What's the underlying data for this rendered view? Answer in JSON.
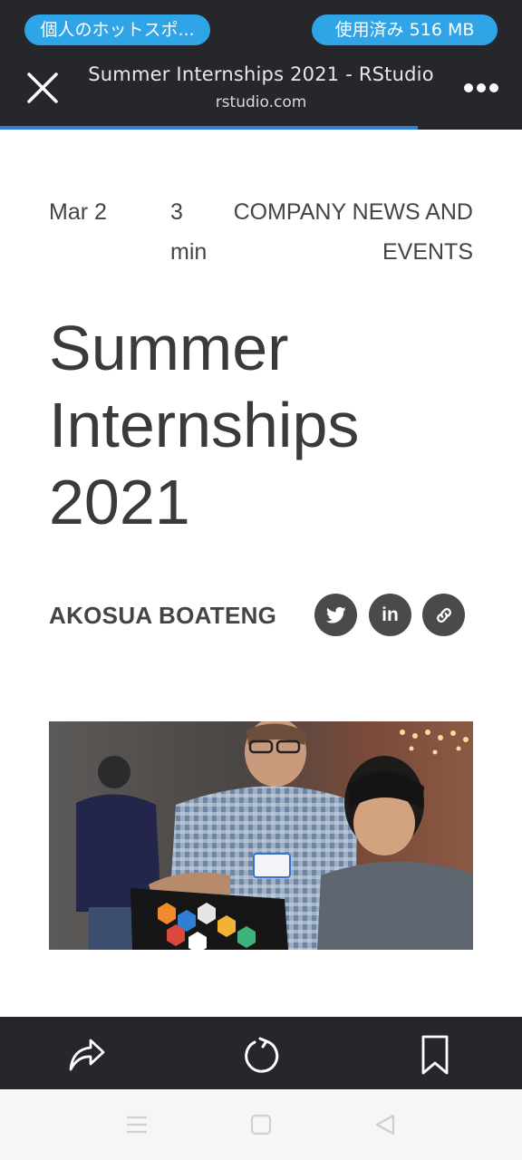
{
  "status": {
    "hotspot": "個人のホットスポ...",
    "data_used": "使用済み 516 MB"
  },
  "browser": {
    "page_title": "Summer Internships 2021 - RStudio",
    "domain": "rstudio.com",
    "load_progress_percent": 80,
    "progress_color": "#2f7fd6",
    "bar_color": "#25272b",
    "pill_color": "#2fa4e7"
  },
  "article": {
    "date": "Mar 2",
    "read_time": "3 min",
    "category": "COMPANY NEWS AND EVENTS",
    "title": "Summer Internships 2021",
    "author": "AKOSUA BOATENG",
    "share_linkedin": "in"
  },
  "icons": {
    "close": "close-icon",
    "more": "more-dots-icon",
    "twitter": "twitter-icon",
    "linkedin": "linkedin-icon",
    "link": "link-icon",
    "share": "share-arrow-icon",
    "reload": "reload-icon",
    "bookmark": "bookmark-icon",
    "nav_menu": "menu-icon",
    "nav_home": "home-square-icon",
    "nav_back": "back-triangle-icon"
  }
}
